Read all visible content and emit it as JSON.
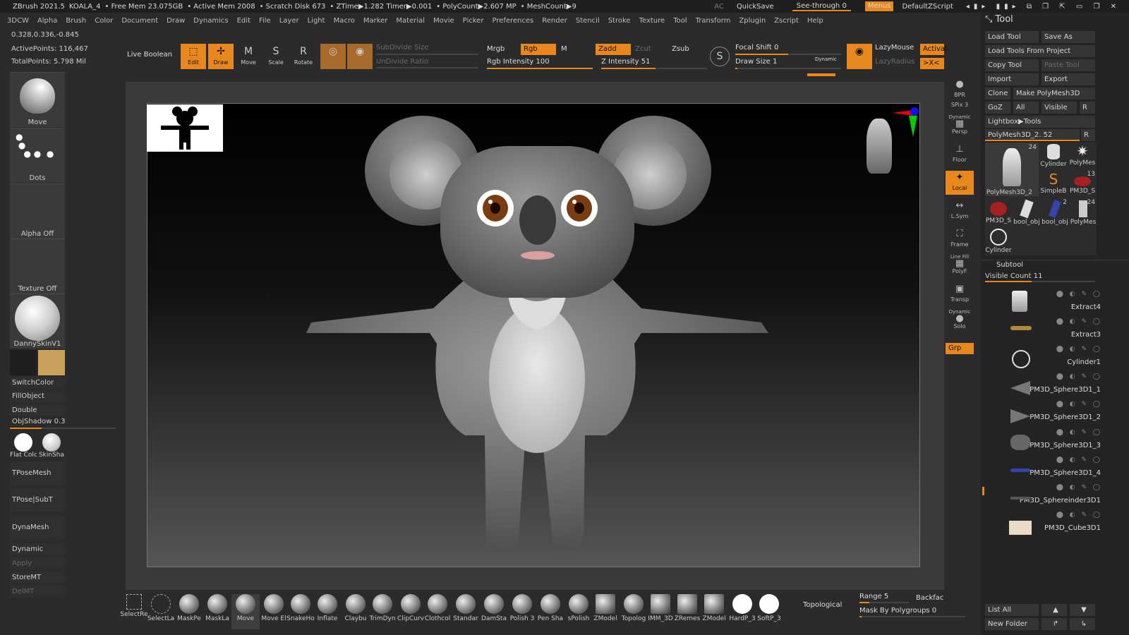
{
  "titlebar": {
    "app": "ZBrush 2021.5",
    "document": "KOALA_4",
    "free_mem": "• Free Mem 23.075GB",
    "active_mem": "• Active Mem 2008",
    "scratch": "• Scratch Disk 673",
    "ztime": "• ZTime▶1.282 Timer▶0.001",
    "polycount": "• PolyCount▶2.607 MP",
    "meshcount": "• MeshCount▶9",
    "ac": "AC",
    "quicksave": "QuickSave",
    "see_through": "See-through  0",
    "menus": "Menus",
    "script": "DefaultZScript"
  },
  "menubar": [
    "3DCW",
    "Alpha",
    "Brush",
    "Color",
    "Document",
    "Draw",
    "Dynamics",
    "Edit",
    "File",
    "Layer",
    "Light",
    "Macro",
    "Marker",
    "Material",
    "Movie",
    "Picker",
    "Preferences",
    "Render",
    "Stencil",
    "Stroke",
    "Texture",
    "Tool",
    "Transform",
    "Zplugin",
    "Zscript",
    "Help"
  ],
  "left": {
    "coords": "0.328,0.336,-0.845",
    "active_points": "ActivePoints: 116,467",
    "total_points": "TotalPoints: 5.798 Mil",
    "brush": "Move",
    "stroke": "Dots",
    "alpha": "Alpha Off",
    "texture": "Texture Off",
    "material": "DannySkinV1",
    "switch_color": "SwitchColor",
    "fill_object": "FillObject",
    "double": "Double",
    "obj_shadow": "ObjShadow 0.3",
    "flat_color": "Flat Colc",
    "skin_shade": "SkinSha",
    "tpose_mesh": "TPoseMesh",
    "tpose_subt": "TPose|SubT",
    "dynamesh": "DynaMesh",
    "dynamic": "Dynamic",
    "apply": "Apply",
    "store_mt": "StoreMT",
    "del_mt": "DelMT",
    "main_color": "#c9a15a"
  },
  "toolbar": {
    "live_boolean": "Live Boolean",
    "edit": "Edit",
    "draw": "Draw",
    "move": "Move",
    "scale": "Scale",
    "rotate": "Rotate",
    "subdivide_size": "SubDivide Size",
    "undivide_ratio": "UnDivide Ratio",
    "mrgb": "Mrgb",
    "rgb": "Rgb",
    "m": "M",
    "rgb_intensity": "Rgb Intensity 100",
    "zadd": "Zadd",
    "zcut": "Zcut",
    "zsub": "Zsub",
    "z_intensity": "Z Intensity 51",
    "focal_shift": "Focal Shift 0",
    "draw_size": "Draw Size 1",
    "dynamic": "Dynamic",
    "lazymouse": "LazyMouse",
    "lazyradius": "LazyRadius",
    "activate": "Activat",
    "xc": ">X<"
  },
  "rshelf": {
    "bpr": "BPR",
    "spix": "SPix 3",
    "persp": "Persp",
    "floor": "Floor",
    "local": "Local",
    "lsym": "L.Sym",
    "frame": "Frame",
    "polyf": "PolyF",
    "line_fill": "Line Fill",
    "transp": "Transp",
    "solo": "Solo",
    "dynamic": "Dynamic",
    "grp": "Grp"
  },
  "tool": {
    "title": "Tool",
    "load_tool": "Load Tool",
    "save_as": "Save As",
    "load_from_project": "Load Tools From Project",
    "copy_tool": "Copy Tool",
    "paste_tool": "Paste Tool",
    "import": "Import",
    "export": "Export",
    "clone": "Clone",
    "make_polymesh": "Make PolyMesh3D",
    "goz": "GoZ",
    "all": "All",
    "visible": "Visible",
    "r": "R",
    "lightbox": "Lightbox▶Tools",
    "current": "PolyMesh3D_2. 52",
    "thumbs": [
      {
        "label": "PolyMesh3D_2",
        "count": "24"
      },
      {
        "label": "Cylinder",
        "count": ""
      },
      {
        "label": "PolyMes",
        "count": ""
      },
      {
        "label": "SimpleB",
        "count": ""
      },
      {
        "label": "PM3D_S",
        "count": "13"
      },
      {
        "label": "PM3D_S",
        "count": ""
      },
      {
        "label": "bool_obj",
        "count": ""
      },
      {
        "label": "bool_obj",
        "count": "2"
      },
      {
        "label": "PolyMes",
        "count": "24"
      },
      {
        "label": "Cylinder",
        "count": ""
      }
    ],
    "subtool_title": "Subtool",
    "visible_count": "Visible Count 11",
    "subtools": [
      "Extract4",
      "Extract3",
      "Cylinder1",
      "PM3D_Sphere3D1_1",
      "PM3D_Sphere3D1_2",
      "PM3D_Sphere3D1_3",
      "PM3D_Sphere3D1_4",
      "PM3D_Sphereinder3D1",
      "PM3D_Cube3D1"
    ],
    "list_all": "List All",
    "new_folder": "New Folder"
  },
  "bottom": {
    "brushes": [
      "SelectRe",
      "SelectLa",
      "MaskPe",
      "MaskLa",
      "Move",
      "Move El",
      "SnakeHo",
      "Inflate",
      "Claybu",
      "TrimDyn",
      "ClipCurv",
      "Clothcol",
      "Standar",
      "DamSta",
      "Polish 3",
      "Pen Sha",
      "sPolish",
      "ZModel",
      "Topolog",
      "IMM_3D",
      "ZRemes",
      "ZModel",
      "HardP_3",
      "SoftP_3"
    ],
    "topological": "Topological",
    "range": "Range 5",
    "backface": "Backfac",
    "mask_by_polygroups": "Mask By Polygroups 0"
  }
}
